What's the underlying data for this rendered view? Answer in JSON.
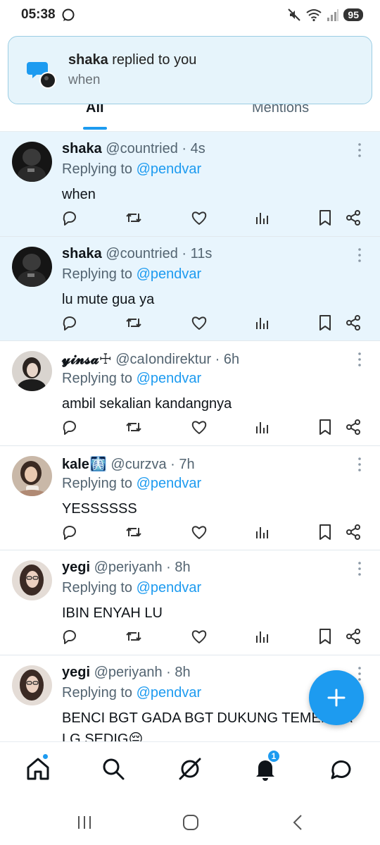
{
  "status_bar": {
    "time": "05:38",
    "battery": "95"
  },
  "notification": {
    "name": "shaka",
    "action": " replied to you",
    "body": "when"
  },
  "tabs": [
    {
      "label": "All"
    },
    {
      "label": "Mentions"
    }
  ],
  "tweets": [
    {
      "name": "shaka",
      "meta": " @countried · 4s",
      "replying_prefix": "Replying to ",
      "replying_handle": "@pendvar",
      "text": "when"
    },
    {
      "name": "shaka",
      "meta": " @countried · 11s",
      "replying_prefix": "Replying to ",
      "replying_handle": "@pendvar",
      "text": "lu mute gua ya"
    },
    {
      "name": "𝔂𝓲𝓷𝓼𝓪☩",
      "meta": " @caIondirektur · 6h",
      "replying_prefix": "Replying to ",
      "replying_handle": "@pendvar",
      "text": "ambil sekalian kandangnya"
    },
    {
      "name": "kale",
      "emoji": "🩻",
      "meta": " @curzva · 7h",
      "replying_prefix": "Replying to ",
      "replying_handle": "@pendvar",
      "text": "YESSSSSS"
    },
    {
      "name": "yegi",
      "meta": " @periyanh · 8h",
      "replying_prefix": "Replying to ",
      "replying_handle": "@pendvar",
      "text": "IBIN ENYAH LU"
    },
    {
      "name": "yegi",
      "meta": " @periyanh · 8h",
      "replying_prefix": "Replying to ",
      "replying_handle": "@pendvar",
      "text": "BENCI BGT GADA BGT DUKUNG TEMEN YA LG SEDIG😔"
    }
  ],
  "bottom_nav": {
    "notifications_badge": "1"
  },
  "colors": {
    "accent": "#1d9bf0",
    "unread_bg": "#e8f5fd",
    "notif_bg": "#e6f4fb"
  },
  "icons": [
    "message-icon",
    "mute-icon",
    "wifi-icon",
    "signal-icon",
    "reply-icon",
    "retweet-icon",
    "like-icon",
    "views-icon",
    "bookmark-icon",
    "share-icon",
    "more-icon",
    "compose-icon",
    "home-icon",
    "search-icon",
    "grok-icon",
    "bell-icon",
    "chat-icon"
  ]
}
